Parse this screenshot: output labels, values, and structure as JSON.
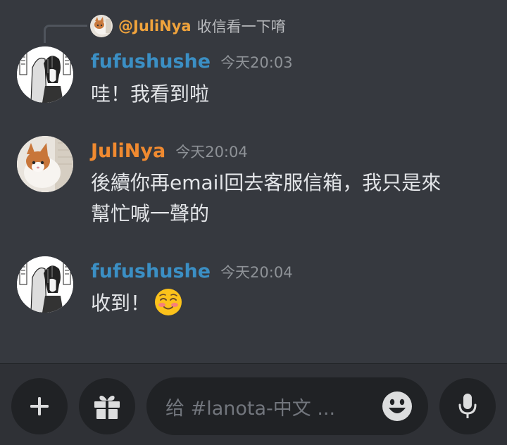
{
  "reply": {
    "mention": "@JuliNya",
    "text": "收信看一下唷"
  },
  "messages": [
    {
      "username": "fufushushe",
      "name_color": "#3b8fc4",
      "timestamp": "今天20:03",
      "text": "哇！我看到啦",
      "avatar": "manga-avatar-icon"
    },
    {
      "username": "JuliNya",
      "name_color": "#f08a30",
      "timestamp": "今天20:04",
      "text_line1": "後續你再email回去客服信箱，我只是來",
      "text_line2": "幫忙喊一聲的",
      "avatar": "cat-avatar-icon"
    },
    {
      "username": "fufushushe",
      "name_color": "#3b8fc4",
      "timestamp": "今天20:04",
      "text": "收到！",
      "emoji": "smiling-blush-emoji",
      "avatar": "manga-avatar-icon"
    }
  ],
  "composer": {
    "placeholder": "给 #lanota-中文 ...",
    "add_icon": "plus-icon",
    "gift_icon": "gift-icon",
    "emoji_icon": "smiley-icon",
    "mic_icon": "microphone-icon"
  },
  "colors": {
    "background": "#36393f",
    "composer_bg": "#2f3136",
    "pill_bg": "#202225",
    "mention": "#f0a33c"
  }
}
